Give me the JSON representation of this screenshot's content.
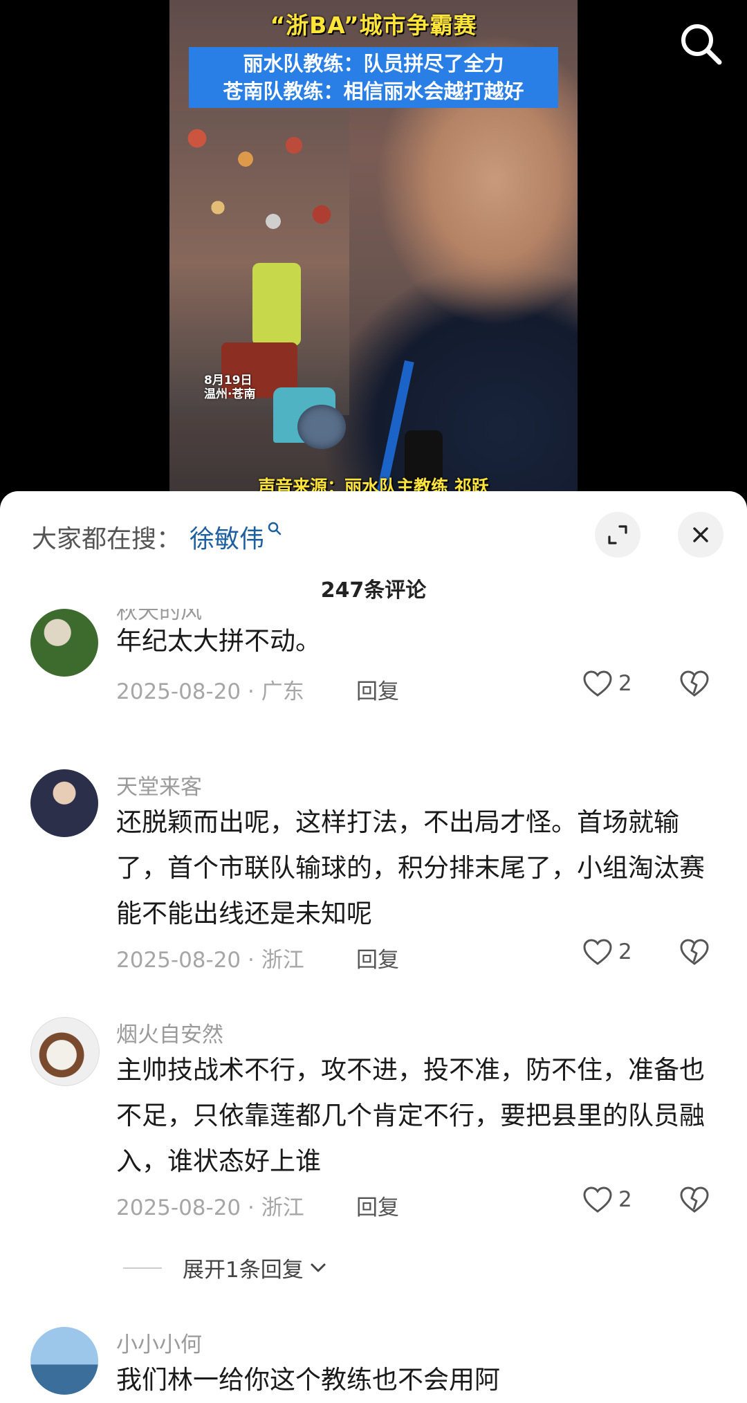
{
  "video": {
    "title_line1": "“浙BA”城市争霸赛",
    "title_line2": "丽水队教练：队员拼尽了全力",
    "title_line3": "苍南队教练：相信丽水会越打越好",
    "date": "8月19日",
    "location": "温州·苍南",
    "caption": "声音来源：丽水队主教练 祁跃",
    "search_icon": "search-icon"
  },
  "sheet": {
    "hot_search_label": "大家都在搜：",
    "hot_search_term": "徐敏伟",
    "comment_count": "247条评论",
    "expand_icon": "expand-icon",
    "close_icon": "close-icon"
  },
  "comments": [
    {
      "user": "秋天的风",
      "text": "年纪太大拼不动。",
      "date": "2025-08-20",
      "region": "广东",
      "reply_label": "回复",
      "likes": "2"
    },
    {
      "user": "天堂来客",
      "text": "还脱颖而出呢，这样打法，不出局才怪。首场就输了，首个市联队输球的，积分排末尾了，小组淘汰赛能不能出线还是未知呢",
      "date": "2025-08-20",
      "region": "浙江",
      "reply_label": "回复",
      "likes": "2"
    },
    {
      "user": "烟火自安然",
      "text": "主帅技战术不行，攻不进，投不准，防不住，准备也不足，只依靠莲都几个肯定不行，要把县里的队员融入，谁状态好上谁",
      "date": "2025-08-20",
      "region": "浙江",
      "reply_label": "回复",
      "likes": "2"
    },
    {
      "user": "小小小何",
      "text": "我们林一给你这个教练也不会用阿"
    }
  ],
  "meta_separator": "·",
  "expand_replies_label": "展开1条回复",
  "colors": {
    "link": "#1e5fa0",
    "title_yellow": "#ffe43a",
    "title_box": "#2a7fe6"
  }
}
